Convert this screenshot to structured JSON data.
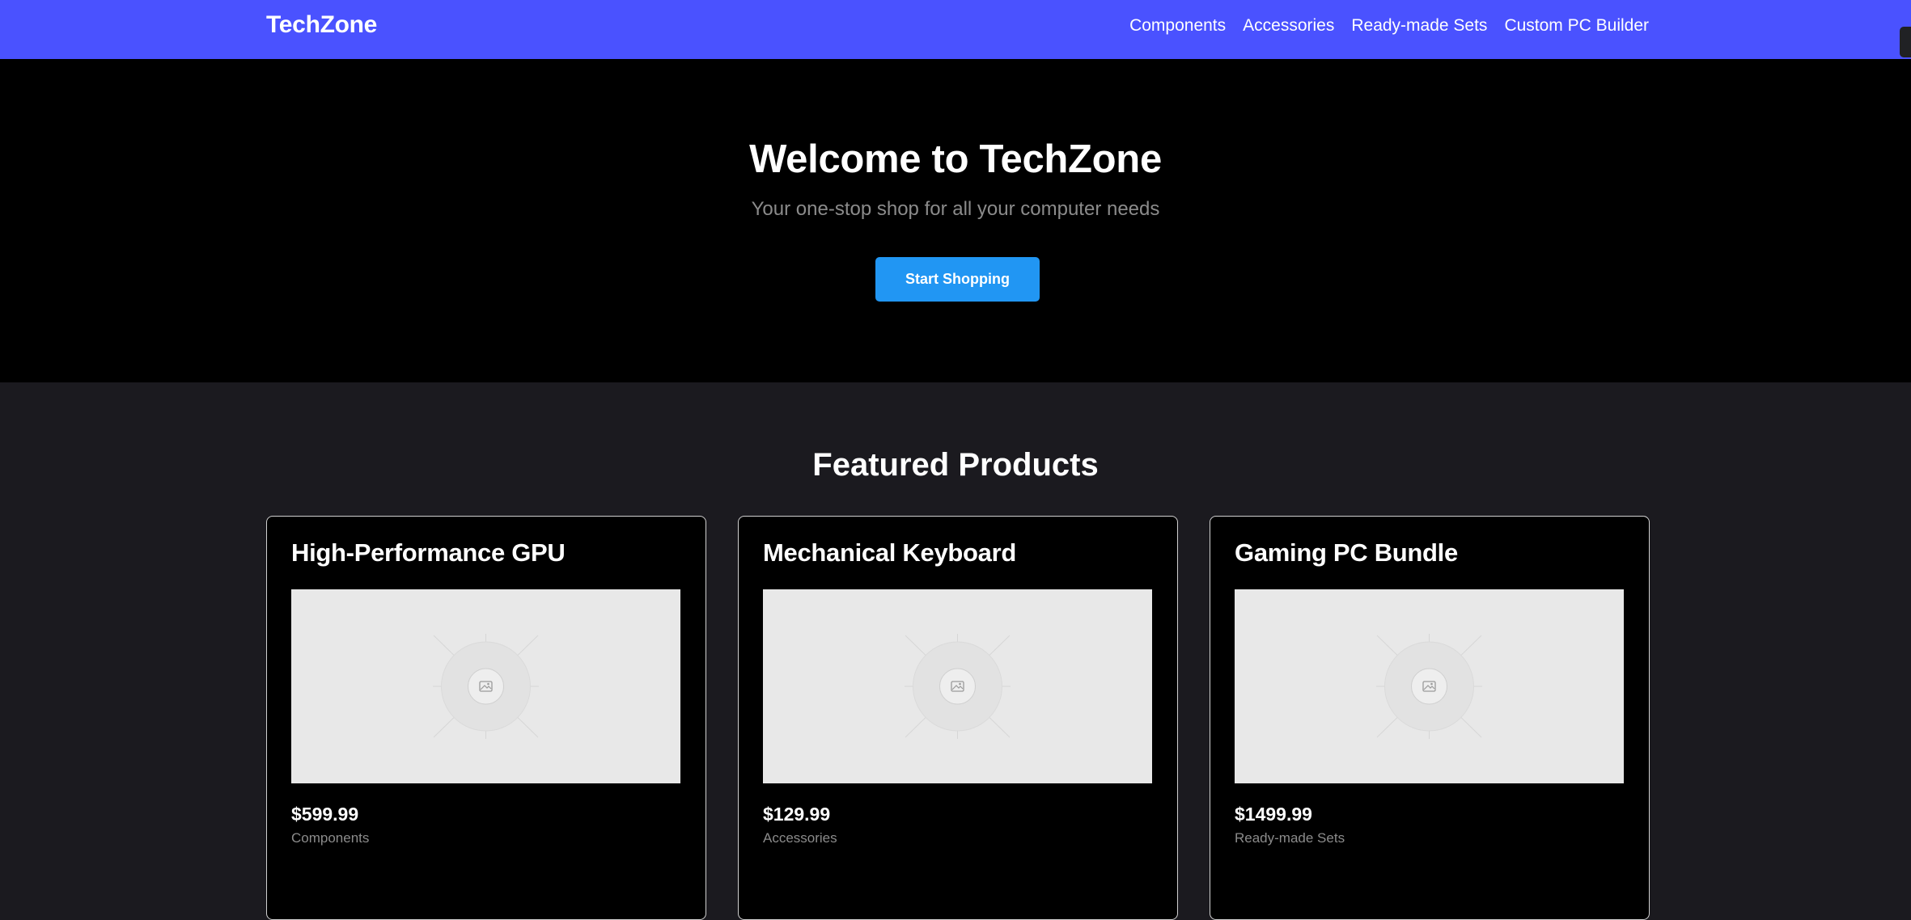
{
  "header": {
    "brand": "TechZone",
    "nav": [
      "Components",
      "Accessories",
      "Ready-made Sets",
      "Custom PC Builder"
    ]
  },
  "hero": {
    "title": "Welcome to TechZone",
    "subtitle": "Your one-stop shop for all your computer needs",
    "cta_label": "Start Shopping"
  },
  "featured": {
    "title": "Featured Products",
    "products": [
      {
        "name": "High-Performance GPU",
        "price": "$599.99",
        "category": "Components",
        "icon": "image-placeholder-icon"
      },
      {
        "name": "Mechanical Keyboard",
        "price": "$129.99",
        "category": "Accessories",
        "icon": "image-placeholder-icon"
      },
      {
        "name": "Gaming PC Bundle",
        "price": "$1499.99",
        "category": "Ready-made Sets",
        "icon": "image-placeholder-icon"
      }
    ]
  },
  "colors": {
    "nav_bg": "#4a52ff",
    "hero_bg": "#000000",
    "section_bg": "#1b1a1f",
    "cta_bg": "#2196f3",
    "muted_text": "#8b8b8b"
  }
}
